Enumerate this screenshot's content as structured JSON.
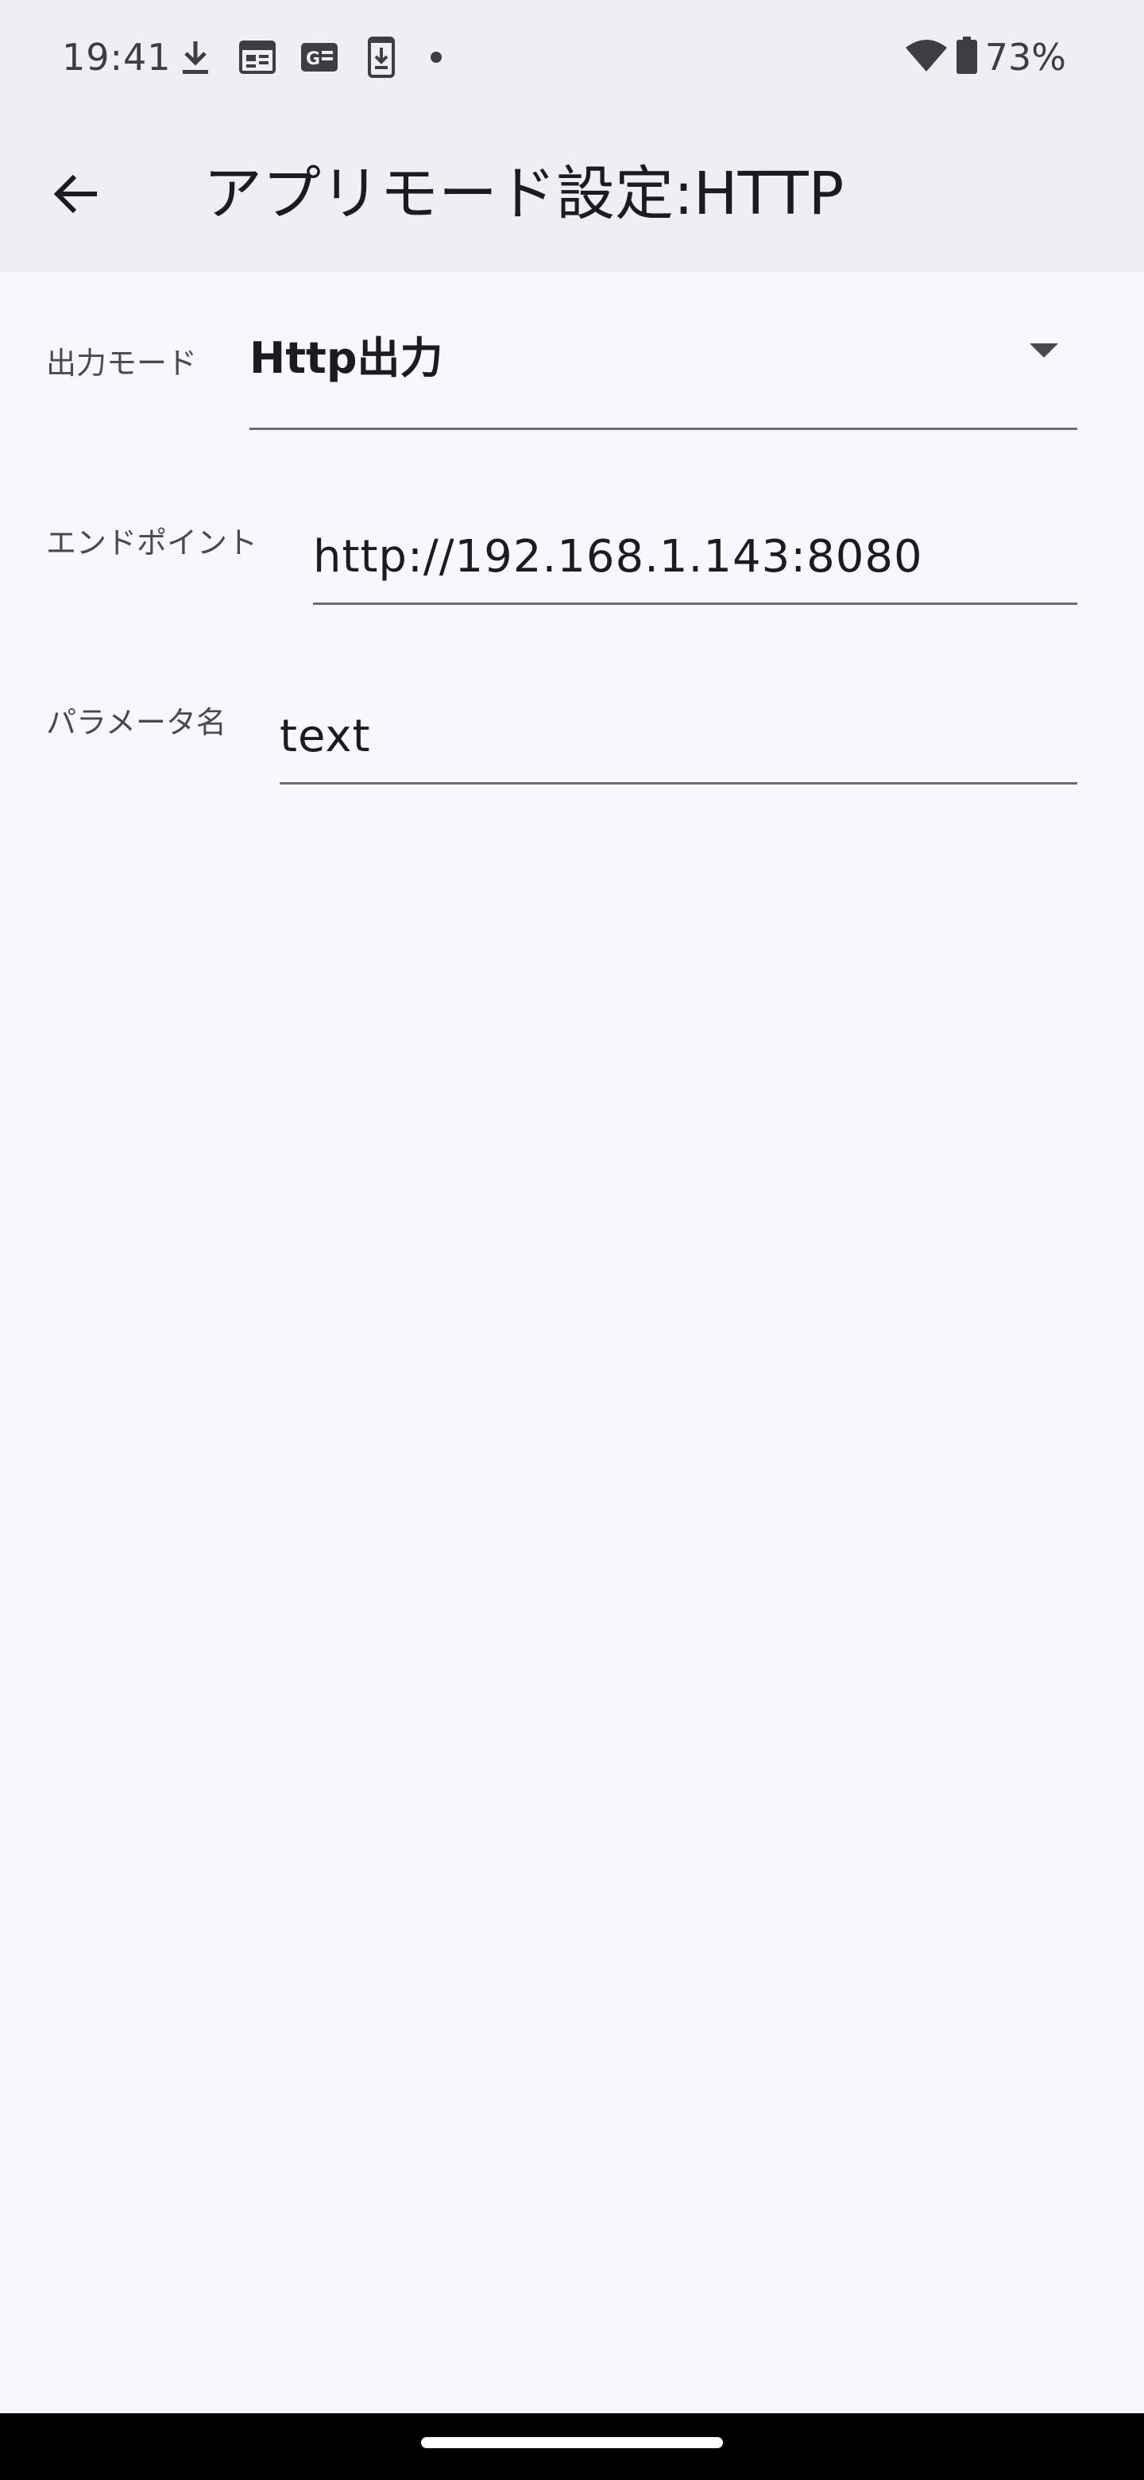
{
  "status_bar": {
    "time": "19:41",
    "left_icons": [
      "download-icon",
      "calendar-icon",
      "google-news-icon",
      "phone-download-icon",
      "notification-dot-icon"
    ],
    "right_icons": [
      "wifi-icon",
      "battery-icon"
    ],
    "battery_percent": "73%"
  },
  "app_bar": {
    "back_icon": "arrow-back-icon",
    "title": "アプリモード設定:HTTP"
  },
  "form": {
    "output_mode": {
      "label": "出力モード",
      "value": "Http出力"
    },
    "endpoint": {
      "label": "エンドポイント",
      "value": "http://192.168.1.143:8080"
    },
    "parameter_name": {
      "label": "パラメータ名",
      "value": "text"
    }
  },
  "colors": {
    "status_and_appbar_bg": "#F1EEF3",
    "page_bg": "#F9F6FD",
    "text_primary": "#1D1B20",
    "text_secondary": "#4A4850",
    "underline": "#6E6B73",
    "nav_bar_bg": "#000000"
  }
}
